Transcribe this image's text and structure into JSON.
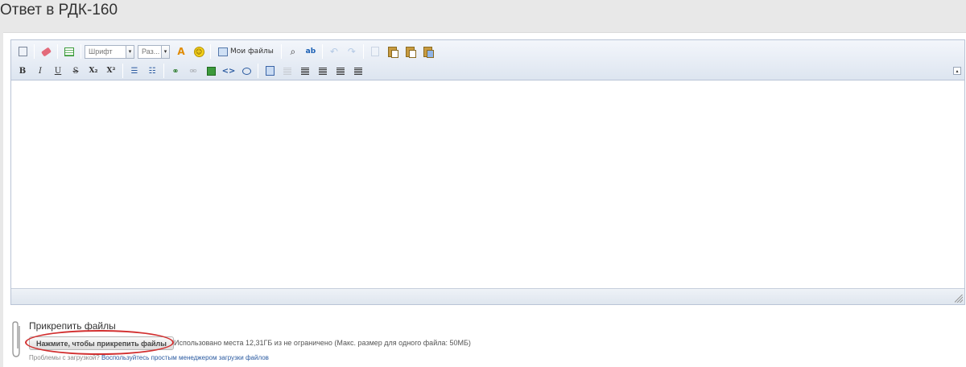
{
  "page": {
    "title": "Ответ в РДК-160"
  },
  "toolbar": {
    "font_combo": {
      "value": "Шрифт",
      "arrow": "▾"
    },
    "size_combo": {
      "value": "Раз...",
      "arrow": "▾"
    },
    "text_color_glyph": "A",
    "my_files_label": "Мои файлы",
    "row2_glyphs": {
      "bold": "B",
      "italic": "I",
      "underline": "U",
      "strike": "S",
      "subscript": "X₂",
      "superscript": "X²",
      "bullet_list": "☰",
      "numbered_list": "☷",
      "code": "<>"
    },
    "collapse_glyph": "▴"
  },
  "attach": {
    "title": "Прикрепить файлы",
    "button_label": "Нажмите, чтобы прикрепить файлы",
    "quota_text": "Использовано места 12,31ГБ из не ограничено (Макс. размер для одного файла: 50МБ)",
    "help_prefix": "Проблемы с загрузкой?",
    "help_link": "Воспользуйтесь простым менеджером загрузки файлов"
  },
  "colors": {
    "highlight": "#d23030",
    "toolbar_border": "#b9c4d6",
    "link": "#2a5aa0"
  }
}
